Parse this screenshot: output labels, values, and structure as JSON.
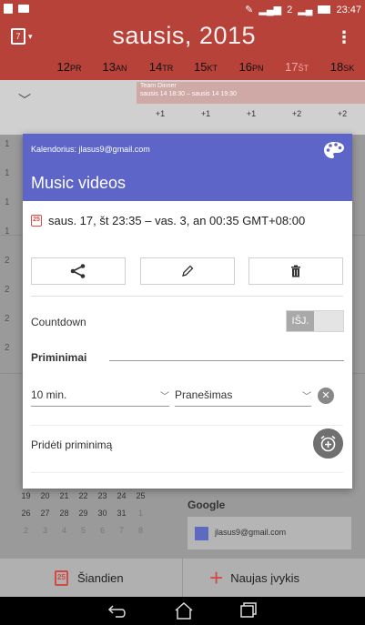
{
  "status": {
    "signal_text": "2",
    "time": "23:47"
  },
  "header": {
    "calendar_icon_num": "7",
    "month_title": "sausis, 2015"
  },
  "days": [
    {
      "num": "12",
      "abbr": "PR"
    },
    {
      "num": "13",
      "abbr": "AN"
    },
    {
      "num": "14",
      "abbr": "TR"
    },
    {
      "num": "15",
      "abbr": "KT"
    },
    {
      "num": "16",
      "abbr": "PN"
    },
    {
      "num": "17",
      "abbr": "ŠT"
    },
    {
      "num": "18",
      "abbr": "SK"
    }
  ],
  "allday": {
    "event_title": "Team Dinner",
    "event_time": "sausis 14 18:30 – sausis 14 19:30",
    "more_counts": [
      "+1",
      "+1",
      "+1",
      "+2",
      "+2"
    ]
  },
  "hours": [
    "1",
    "1",
    "1",
    "1",
    "2",
    "2",
    "2",
    "2"
  ],
  "event_card": {
    "calendar_label": "Kalendorius: jlasus9@gmail.com",
    "title": "Music videos",
    "date_icon_num": "25",
    "datetime": "saus. 17, št 23:35 – vas. 3, an 00:35  GMT+08:00",
    "countdown_label": "Countdown",
    "countdown_toggle": "IŠJ.",
    "reminders_label": "Priminimai",
    "reminder_time": "10 min.",
    "reminder_type": "Pranešimas",
    "add_reminder_label": "Pridėti priminimą"
  },
  "mini_cal": {
    "rows": [
      [
        "19",
        "20",
        "21",
        "22",
        "23",
        "24",
        "25"
      ],
      [
        "26",
        "27",
        "28",
        "29",
        "30",
        "31",
        "1"
      ],
      [
        "2",
        "3",
        "4",
        "5",
        "6",
        "7",
        "8"
      ]
    ]
  },
  "accounts": {
    "google_label": "Google",
    "account_email": "jlasus9@gmail.com"
  },
  "bottom": {
    "today_icon_num": "25",
    "today_label": "Šiandien",
    "new_event_label": "Naujas įvykis"
  },
  "colors": {
    "header_red": "#b6423a",
    "card_purple": "#5d66c8",
    "accent_red": "#d24a43"
  }
}
